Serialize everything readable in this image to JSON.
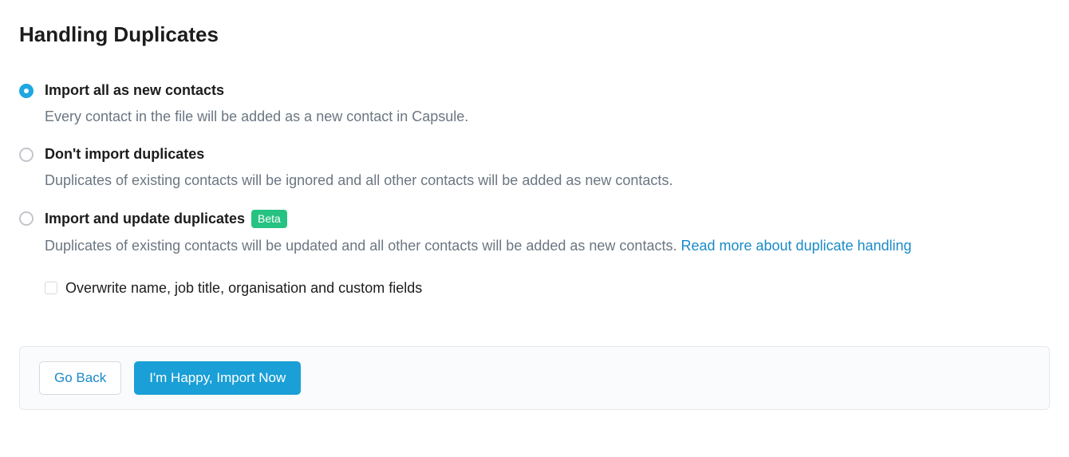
{
  "title": "Handling Duplicates",
  "options": [
    {
      "label": "Import all as new contacts",
      "description": "Every contact in the file will be added as a new contact in Capsule.",
      "selected": true
    },
    {
      "label": "Don't import duplicates",
      "description": "Duplicates of existing contacts will be ignored and all other contacts will be added as new contacts.",
      "selected": false
    },
    {
      "label": "Import and update duplicates",
      "badge": "Beta",
      "description": "Duplicates of existing contacts will be updated and all other contacts will be added as new contacts. ",
      "link_text": "Read more about duplicate handling",
      "selected": false
    }
  ],
  "checkbox": {
    "label": "Overwrite name, job title, organisation and custom fields",
    "checked": false
  },
  "buttons": {
    "back": "Go Back",
    "confirm": "I'm Happy, Import Now"
  }
}
